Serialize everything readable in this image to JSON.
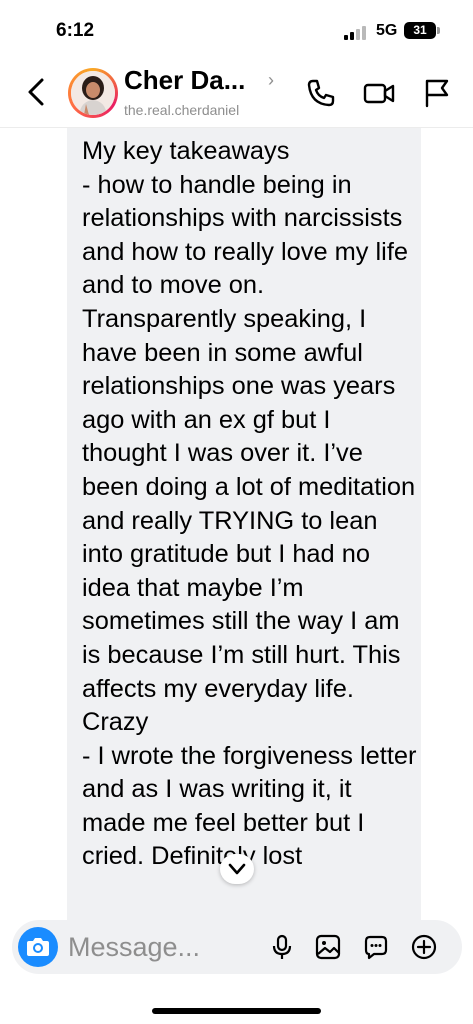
{
  "status_bar": {
    "time": "6:12",
    "network": "5G",
    "battery": "31"
  },
  "header": {
    "name": "Cher Da...",
    "username": "the.real.cherdaniel"
  },
  "message": {
    "text": "My key takeaways\n- how to handle being in relationships with narcissists and how to really love my life and to move on. Transparently speaking, I have been in some awful relationships one was years ago with an ex gf but I thought I was over it. I’ve been doing a lot of meditation and really TRYING to lean into gratitude but I had no idea that maybe I’m sometimes still the way I am is because I’m still hurt. This affects my everyday life. Crazy\n- I wrote the forgiveness letter and as I was writing it, it made me feel better but I cried. Definitely lost"
  },
  "composer": {
    "placeholder": "Message..."
  },
  "icons": {
    "back": "chevron-left-icon",
    "call": "phone-icon",
    "video": "video-camera-icon",
    "flag": "flag-icon",
    "camera": "camera-icon",
    "mic": "microphone-icon",
    "gallery": "image-icon",
    "sticker": "sticker-chat-icon",
    "add": "plus-circle-icon"
  },
  "colors": {
    "accent": "#1a8cff",
    "bubble": "#f0f1f3",
    "secondary_text": "#8e8e8e"
  }
}
